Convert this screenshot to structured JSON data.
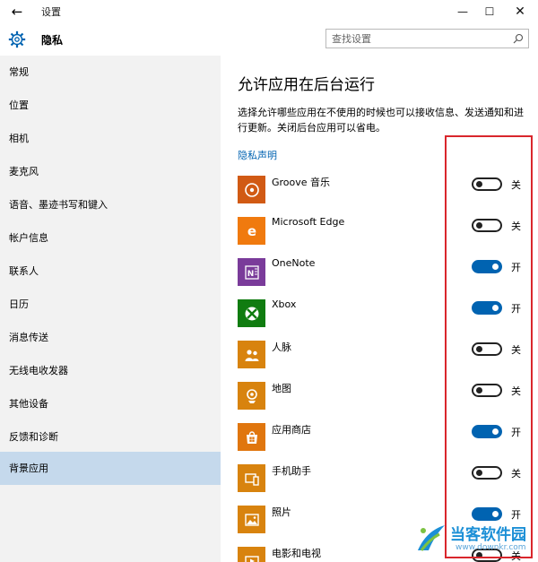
{
  "window": {
    "title": "设置",
    "back_symbol": "←",
    "min_symbol": "—",
    "max_symbol": "☐",
    "close_symbol": "✕"
  },
  "header": {
    "section": "隐私",
    "search_placeholder": "查找设置"
  },
  "sidebar": {
    "items": [
      {
        "label": "常规"
      },
      {
        "label": "位置"
      },
      {
        "label": "相机"
      },
      {
        "label": "麦克风"
      },
      {
        "label": "语音、墨迹书写和键入"
      },
      {
        "label": "帐户信息"
      },
      {
        "label": "联系人"
      },
      {
        "label": "日历"
      },
      {
        "label": "消息传送"
      },
      {
        "label": "无线电收发器"
      },
      {
        "label": "其他设备"
      },
      {
        "label": "反馈和诊断"
      },
      {
        "label": "背景应用"
      }
    ],
    "active_index": 12
  },
  "main": {
    "title": "允许应用在后台运行",
    "description": "选择允许哪些应用在不使用的时候也可以接收信息、发送通知和进行更新。关闭后台应用可以省电。",
    "privacy_link": "隐私声明",
    "apps": [
      {
        "name": "Groove 音乐",
        "on": false,
        "state": "关",
        "icon": "groove-music-icon",
        "color": "#d15a14"
      },
      {
        "name": "Microsoft Edge",
        "on": false,
        "state": "关",
        "icon": "edge-icon",
        "color": "#f07a0e"
      },
      {
        "name": "OneNote",
        "on": true,
        "state": "开",
        "icon": "onenote-icon",
        "color": "#7a3b9a"
      },
      {
        "name": "Xbox",
        "on": true,
        "state": "开",
        "icon": "xbox-icon",
        "color": "#107c10"
      },
      {
        "name": "人脉",
        "on": false,
        "state": "关",
        "icon": "people-icon",
        "color": "#d8830e"
      },
      {
        "name": "地图",
        "on": false,
        "state": "关",
        "icon": "maps-icon",
        "color": "#d8830e"
      },
      {
        "name": "应用商店",
        "on": true,
        "state": "开",
        "icon": "store-icon",
        "color": "#e0760e"
      },
      {
        "name": "手机助手",
        "on": false,
        "state": "关",
        "icon": "phone-companion-icon",
        "color": "#d8830e"
      },
      {
        "name": "照片",
        "on": true,
        "state": "开",
        "icon": "photos-icon",
        "color": "#d8830e"
      },
      {
        "name": "电影和电视",
        "on": false,
        "state": "关",
        "icon": "movies-tv-icon",
        "color": "#d8830e"
      }
    ]
  },
  "watermark": {
    "text": "当客软件园",
    "url": "www.downkr.com"
  },
  "colors": {
    "accent": "#0063b1",
    "highlight": "#d9262c",
    "sidebar_bg": "#f2f2f2",
    "sidebar_active": "#c5d9ec"
  }
}
